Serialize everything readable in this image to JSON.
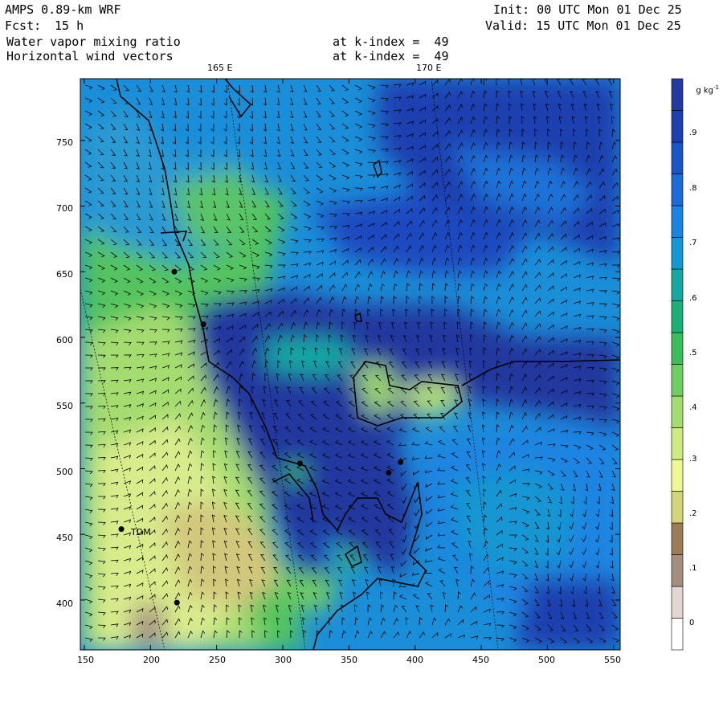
{
  "header": {
    "model": "AMPS 0.89-km WRF",
    "init": "Init: 00 UTC Mon 01 Dec 25",
    "fcst_label": "Fcst:",
    "fcst_value": "15 h",
    "valid": "Valid: 15 UTC Mon 01 Dec 25",
    "field1": "Water vapor mixing ratio",
    "field2": "Horizontal wind vectors",
    "field1_level": "at k-index =  49",
    "field2_level": "at k-index =  49"
  },
  "longitude_labels": [
    "165 E",
    "170 E"
  ],
  "axes": {
    "x_ticks": [
      "150",
      "200",
      "250",
      "300",
      "350",
      "400",
      "450",
      "500",
      "550"
    ],
    "y_ticks": [
      "750",
      "700",
      "650",
      "600",
      "550",
      "500",
      "450",
      "400"
    ],
    "xlim": [
      147,
      555
    ],
    "ylim": [
      362,
      797
    ]
  },
  "colorbar": {
    "unit": "g kg",
    "unit_exp": "-1",
    "tick_labels": [
      "0",
      ".1",
      ".2",
      ".3",
      ".4",
      ".5",
      ".6",
      ".7",
      ".8",
      ".9"
    ],
    "colors": [
      "#ffffff",
      "#e2d7d2",
      "#a58e80",
      "#9b7d55",
      "#d3d57c",
      "#f0f796",
      "#cdeb82",
      "#a4dc70",
      "#6fcd63",
      "#3cbd5b",
      "#1eae78",
      "#16a7a3",
      "#1696d2",
      "#1b84e2",
      "#1c6bd8",
      "#1a55c8",
      "#1d3fb0",
      "#243a9f"
    ]
  },
  "station_label": "TDM",
  "chart_data": {
    "type": "heatmap",
    "title": "Water vapor mixing ratio",
    "xlim": [
      147,
      555
    ],
    "ylim": [
      362,
      797
    ],
    "x_ticks": [
      150,
      200,
      250,
      300,
      350,
      400,
      450,
      500,
      550
    ],
    "y_ticks": [
      400,
      450,
      500,
      550,
      600,
      650,
      700,
      750
    ],
    "value_range": [
      0,
      0.95
    ],
    "unit": "g kg-1",
    "stations": [
      {
        "x": 218,
        "y": 650
      },
      {
        "x": 240,
        "y": 610
      },
      {
        "x": 313,
        "y": 504
      },
      {
        "x": 380,
        "y": 497
      },
      {
        "x": 389,
        "y": 505
      },
      {
        "x": 178,
        "y": 454,
        "label": "TDM"
      },
      {
        "x": 220,
        "y": 398
      }
    ]
  }
}
